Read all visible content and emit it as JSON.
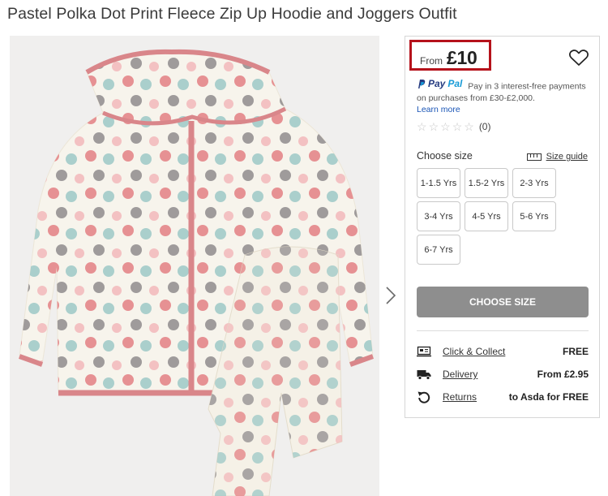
{
  "product": {
    "title": "Pastel Polka Dot Print Fleece Zip Up Hoodie and Joggers Outfit"
  },
  "price": {
    "prefix": "From",
    "value": "£10"
  },
  "paypal": {
    "brand_pay": "Pay",
    "brand_pal": "Pal",
    "text": "Pay in 3 interest-free payments on purchases from £30-£2,000.",
    "learn_more": "Learn more"
  },
  "rating": {
    "stars_filled": 0,
    "stars_total": 5,
    "count": "(0)"
  },
  "size_section": {
    "label": "Choose size",
    "guide": "Size guide",
    "options": [
      "1-1.5 Yrs",
      "1.5-2 Yrs",
      "2-3 Yrs",
      "3-4 Yrs",
      "4-5 Yrs",
      "5-6 Yrs",
      "6-7 Yrs"
    ]
  },
  "cta": {
    "label": "CHOOSE SIZE"
  },
  "fulfilment": [
    {
      "icon": "click-collect-icon",
      "label": "Click & Collect",
      "value": "FREE"
    },
    {
      "icon": "delivery-truck-icon",
      "label": "Delivery",
      "value": "From £2.95"
    },
    {
      "icon": "returns-icon",
      "label": "Returns",
      "value": "to Asda for FREE"
    }
  ],
  "colors": {
    "price_highlight": "#b5121b",
    "cta_background": "#8e8e8e",
    "paypal_dark": "#253b80",
    "paypal_light": "#179bd7",
    "link_blue": "#1a55b6",
    "garment_trim": "#d9868a"
  }
}
